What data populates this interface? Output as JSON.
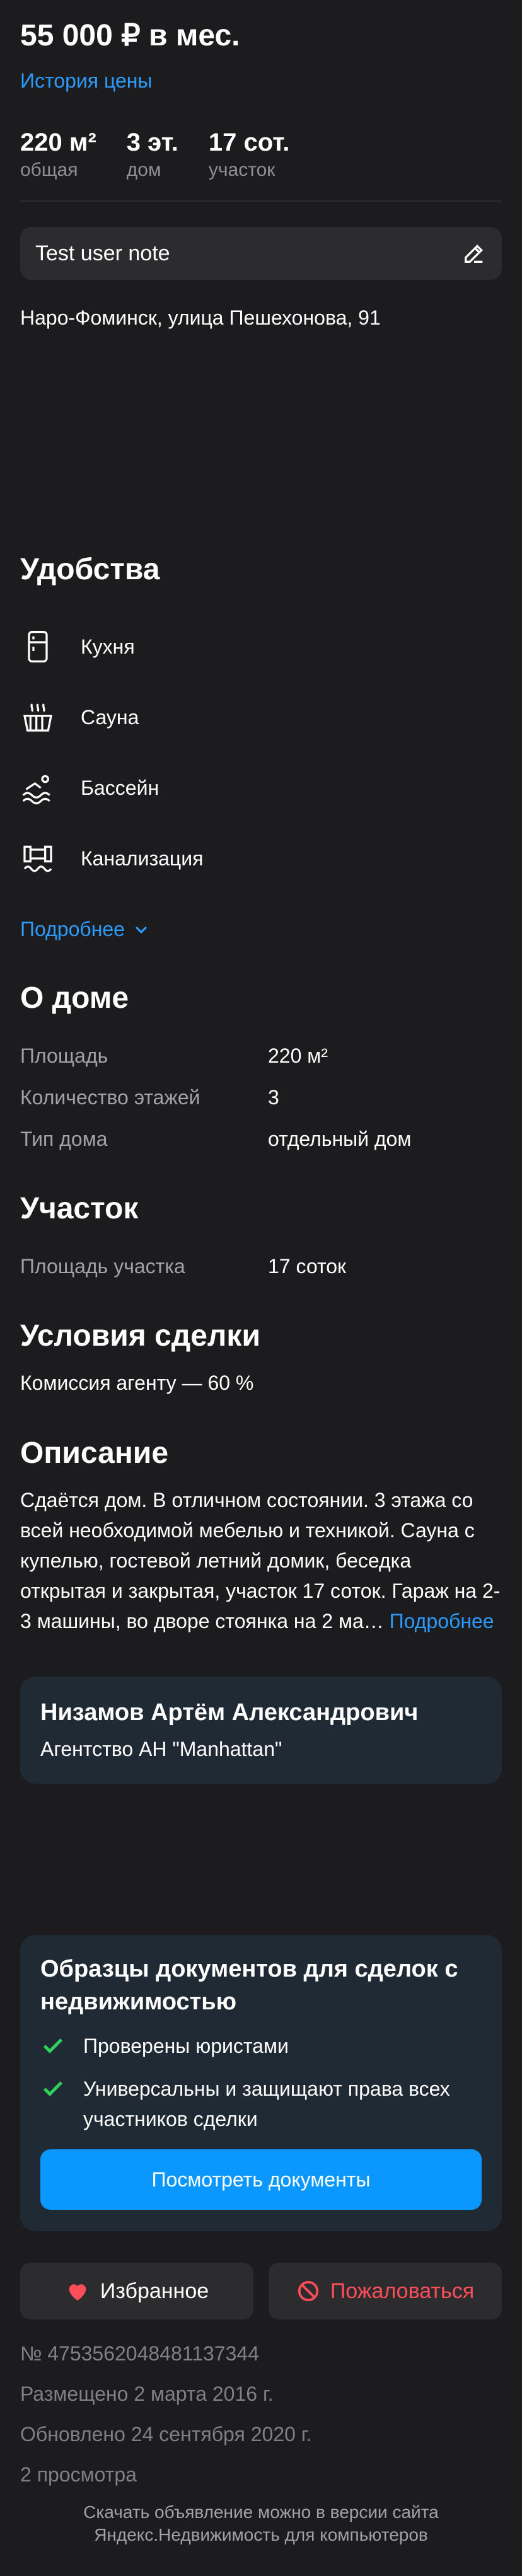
{
  "listing": {
    "price": "55 000 ₽ в мес.",
    "price_history_link": "История цены",
    "stats": [
      {
        "value": "220 м²",
        "label": "общая"
      },
      {
        "value": "3 эт.",
        "label": "дом"
      },
      {
        "value": "17 сот.",
        "label": "участок"
      }
    ],
    "user_note": "Test user note",
    "address": "Наро-Фоминск, улица Пешехонова, 91"
  },
  "amenities": {
    "title": "Удобства",
    "items": [
      {
        "label": "Кухня",
        "icon": "fridge-icon"
      },
      {
        "label": "Сауна",
        "icon": "sauna-icon"
      },
      {
        "label": "Бассейн",
        "icon": "pool-icon"
      },
      {
        "label": "Канализация",
        "icon": "sewer-icon"
      }
    ],
    "more": "Подробнее"
  },
  "house": {
    "title": "О доме",
    "rows": [
      {
        "k": "Площадь",
        "v": "220 м²"
      },
      {
        "k": "Количество этажей",
        "v": "3"
      },
      {
        "k": "Тип дома",
        "v": "отдельный дом"
      }
    ]
  },
  "plot": {
    "title": "Участок",
    "rows": [
      {
        "k": "Площадь участка",
        "v": "17 соток"
      }
    ]
  },
  "deal": {
    "title": "Условия сделки",
    "text": "Комиссия агенту — 60 %"
  },
  "description": {
    "title": "Описание",
    "text": "Сдаётся дом. В отличном состоянии. 3 этажа со всей необходимой мебелью и техникой. Сауна с купелью, гостевой летний домик, беседка открытая и закрытая, участок 17 соток. Гараж на 2-3 машины, во дворе стоянка на 2 ма…",
    "more": "Подробнее"
  },
  "agent": {
    "name": "Низамов Артём Александрович",
    "company": "Агентство АН \"Manhattan\""
  },
  "docs": {
    "title": "Образцы документов для сделок с недвижимостью",
    "points": [
      "Проверены юристами",
      "Универсальны и защищают права всех участников сделки"
    ],
    "button": "Посмотреть документы"
  },
  "actions": {
    "favorite": "Избранное",
    "complain": "Пожаловаться"
  },
  "meta": {
    "id": "№ 4753562048481137344",
    "posted": "Размещено 2 марта 2016 г.",
    "updated": "Обновлено 24 сентября 2020 г.",
    "views": "2 просмотра"
  },
  "footer": {
    "line1": "Скачать объявление можно в версии сайта",
    "line2": "Яндекс.Недвижимость для компьютеров"
  },
  "colors": {
    "accent": "#2b9bff",
    "button": "#0a98ff",
    "danger": "#ff4d5a",
    "card": "#1f2a34"
  }
}
